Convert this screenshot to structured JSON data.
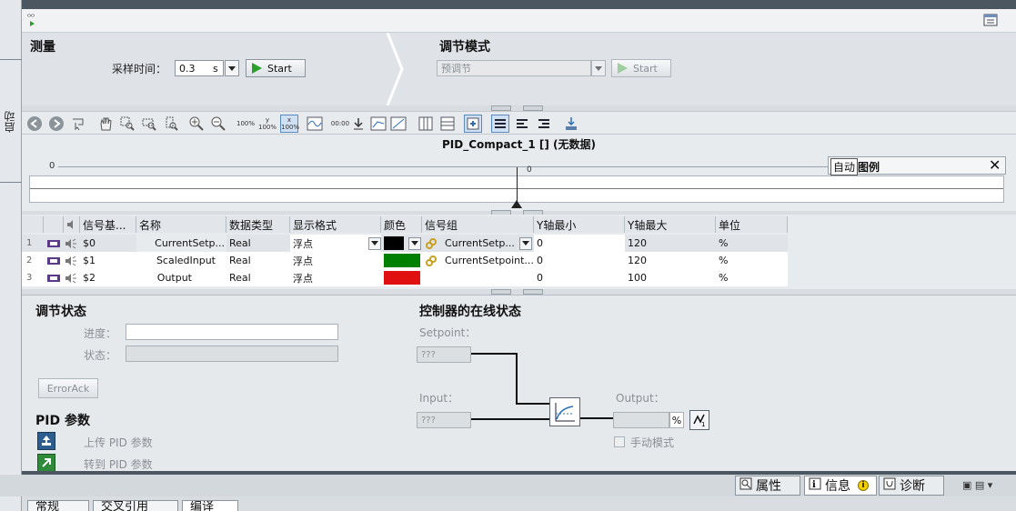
{
  "left_strip": {
    "label": "启动"
  },
  "measurement": {
    "title": "测量",
    "sample_time_label": "采样时间：",
    "sample_time_value": "0.3",
    "sample_time_unit": "s",
    "start_label": "Start"
  },
  "tuning_mode": {
    "title": "调节模式",
    "mode_value": "预调节",
    "start_label": "Start"
  },
  "chart": {
    "title": "PID_Compact_1 [] (无数据)",
    "axis_left_tick": "0",
    "cursor_tick": "0",
    "legend_mode": "自动",
    "legend_title": "图例",
    "toolbar_labels": {
      "zoom_100": "100%",
      "y_100": "y 100%",
      "x_100": "x 100%",
      "time": "00:00"
    }
  },
  "signal_table": {
    "headers": [
      "信号基...",
      "名称",
      "数据类型",
      "显示格式",
      "颜色",
      "信号组",
      "Y轴最小",
      "Y轴最大",
      "单位"
    ],
    "rows": [
      {
        "num": "1",
        "base": "$0",
        "name": "CurrentSetp...",
        "type": "Real",
        "format": "浮点",
        "color": "#000000",
        "group": "CurrentSetp...",
        "ymin": "0",
        "ymax": "120",
        "unit": "%"
      },
      {
        "num": "2",
        "base": "$1",
        "name": "ScaledInput",
        "type": "Real",
        "format": "浮点",
        "color": "#008000",
        "group": "CurrentSetpoint...",
        "ymin": "0",
        "ymax": "120",
        "unit": "%"
      },
      {
        "num": "3",
        "base": "$2",
        "name": "Output",
        "type": "Real",
        "format": "浮点",
        "color": "#e01010",
        "group": "",
        "ymin": "0",
        "ymax": "100",
        "unit": "%"
      }
    ]
  },
  "tuning_status": {
    "title": "调节状态",
    "progress_label": "进度：",
    "status_label": "状态：",
    "error_ack_label": "ErrorAck"
  },
  "pid_params": {
    "title": "PID 参数",
    "upload_label": "上传 PID 参数",
    "goto_label": "转到 PID 参数"
  },
  "online_status": {
    "title": "控制器的在线状态",
    "setpoint_label": "Setpoint：",
    "setpoint_value": "???",
    "input_label": "Input：",
    "input_value": "???",
    "output_label": "Output：",
    "output_unit": "%",
    "manual_mode_label": "手动模式"
  },
  "inspector_tabs": {
    "properties": "属性",
    "info": "信息",
    "diagnostics": "诊断"
  },
  "bottom_tabs": [
    "常规",
    "交叉引用",
    "编译"
  ]
}
